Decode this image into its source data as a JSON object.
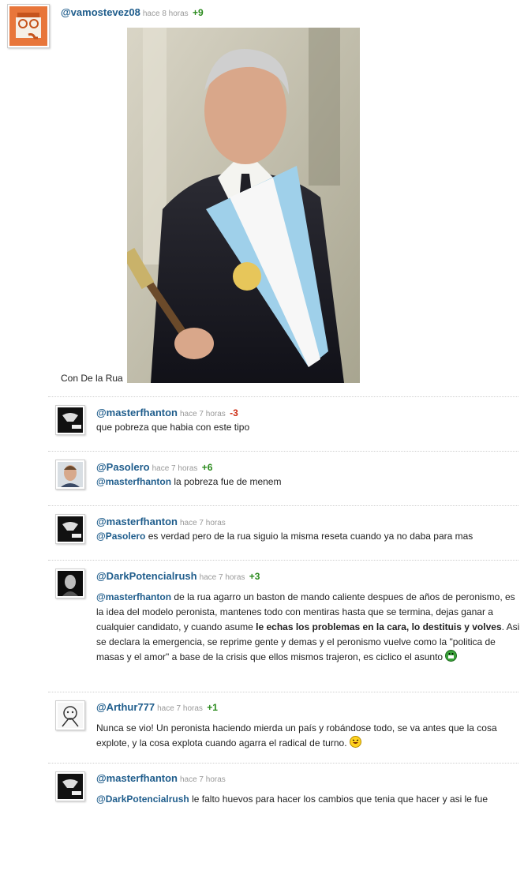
{
  "post": {
    "user": "@vamostevez08",
    "time": "hace 8 horas",
    "score": "+9",
    "caption": "Con De la Rua"
  },
  "replies": [
    {
      "user": "@masterfhanton",
      "time": "hace 7 horas",
      "score": "-3",
      "text": "que pobreza que habia con este tipo"
    },
    {
      "user": "@Pasolero",
      "time": "hace 7 horas",
      "score": "+6",
      "mention": "@masterfhanton",
      "text": "la pobreza fue de menem"
    },
    {
      "user": "@masterfhanton",
      "time": "hace 7 horas",
      "mention": "@Pasolero",
      "text": "es verdad pero de la rua siguio la misma reseta cuando ya no daba para mas"
    },
    {
      "user": "@DarkPotencialrush",
      "time": "hace 7 horas",
      "score": "+3",
      "mention": "@masterfhanton",
      "text_a": "de la rua agarro un baston de mando caliente despues de años de peronismo, es la idea del modelo peronista, mantenes todo con mentiras hasta que se termina, dejas ganar a cualquier candidato, y cuando asume",
      "text_bold": "le echas los problemas en la cara, lo destituis y volves",
      "text_b": ". Asi se declara la emergencia, se reprime gente y demas y el peronismo vuelve como la \"politica de masas y el amor\" a base de la crisis que ellos mismos trajeron, es ciclico el asunto"
    },
    {
      "user": "@Arthur777",
      "time": "hace 7 horas",
      "score": "+1",
      "text": "Nunca se vio! Un peronista haciendo mierda un país y robándose todo, se va antes que la cosa explote, y la cosa explota cuando agarra el radical de turno."
    },
    {
      "user": "@masterfhanton",
      "time": "hace 7 horas",
      "mention": "@DarkPotencialrush",
      "text": "le falto huevos para hacer los cambios que tenia que hacer y asi le fue"
    }
  ],
  "colors": {
    "link": "#1f5d8c",
    "positive": "#2a8a1c",
    "negative": "#cc2b12",
    "time": "#999999"
  }
}
